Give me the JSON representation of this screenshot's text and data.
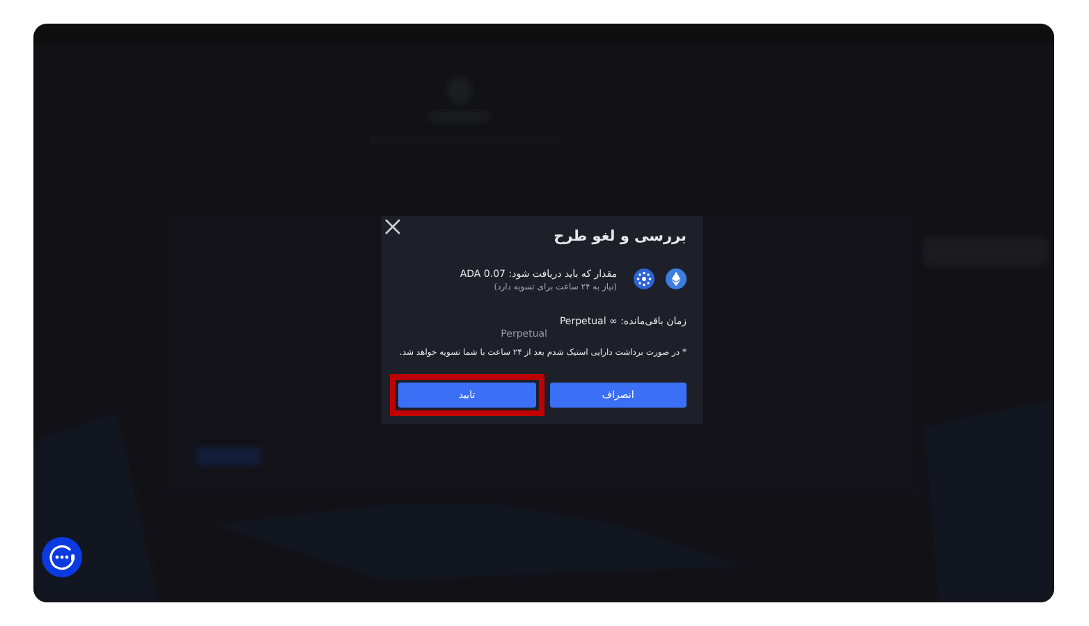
{
  "dialog": {
    "title": "بررسی و لغو طرح",
    "amount_label": "مقدار که باید دریافت شود:",
    "amount_value": "ADA 0.07",
    "settlement_note": "(نیاز به ۲۴ ساعت برای تسویه دارد)",
    "remaining_label": "زمان باقی‌مانده:",
    "remaining_value": "Perpetual ∞",
    "term": "Perpetual",
    "warning": "* در صورت برداشت دارایی استیک شدم بعد از ۲۴ ساعت با شما تسویه خواهد شد.",
    "buttons": [
      {
        "label": "انصراف",
        "highlighted": false
      },
      {
        "label": "تایید",
        "highlighted": true
      }
    ]
  }
}
